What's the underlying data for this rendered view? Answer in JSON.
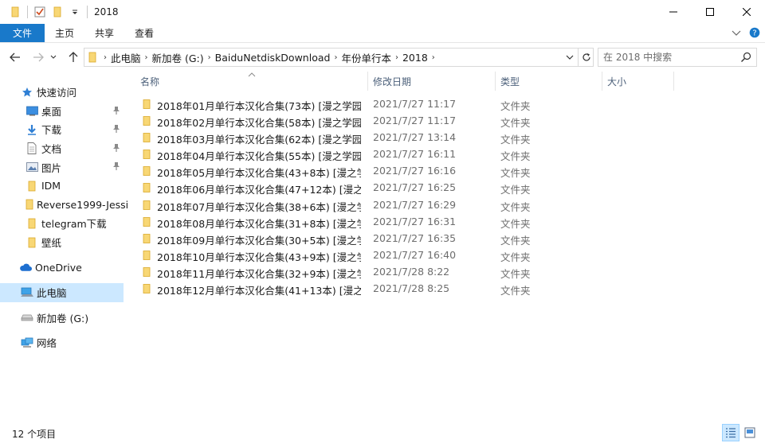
{
  "window": {
    "title": "2018"
  },
  "ribbon": {
    "tabs": [
      "文件",
      "主页",
      "共享",
      "查看"
    ]
  },
  "address": {
    "crumbs": [
      "此电脑",
      "新加卷 (G:)",
      "BaiduNetdiskDownload",
      "年份单行本",
      "2018"
    ]
  },
  "search": {
    "placeholder": "在 2018 中搜索"
  },
  "sidebar": {
    "quick_access": "快速访问",
    "items": [
      {
        "label": "桌面",
        "icon": "desktop-icon",
        "pinned": true
      },
      {
        "label": "下载",
        "icon": "download-icon",
        "pinned": true
      },
      {
        "label": "文档",
        "icon": "document-icon",
        "pinned": true
      },
      {
        "label": "图片",
        "icon": "picture-icon",
        "pinned": true
      },
      {
        "label": "IDM",
        "icon": "folder-icon",
        "pinned": false
      },
      {
        "label": "Reverse1999-Jessi",
        "icon": "folder-icon",
        "pinned": false
      },
      {
        "label": "telegram下载",
        "icon": "folder-icon",
        "pinned": false
      },
      {
        "label": "壁纸",
        "icon": "folder-icon",
        "pinned": false
      }
    ],
    "onedrive": "OneDrive",
    "this_pc": "此电脑",
    "drive": "新加卷 (G:)",
    "network": "网络"
  },
  "columns": {
    "name": "名称",
    "date": "修改日期",
    "type": "类型",
    "size": "大小"
  },
  "files": [
    {
      "name": "2018年01月单行本汉化合集(73本) [漫之学园...",
      "date": "2021/7/27 11:17",
      "type": "文件夹"
    },
    {
      "name": "2018年02月单行本汉化合集(58本) [漫之学园...",
      "date": "2021/7/27 11:17",
      "type": "文件夹"
    },
    {
      "name": "2018年03月单行本汉化合集(62本) [漫之学园...",
      "date": "2021/7/27 13:14",
      "type": "文件夹"
    },
    {
      "name": "2018年04月单行本汉化合集(55本) [漫之学园...",
      "date": "2021/7/27 16:11",
      "type": "文件夹"
    },
    {
      "name": "2018年05月单行本汉化合集(43+8本) [漫之学...",
      "date": "2021/7/27 16:16",
      "type": "文件夹"
    },
    {
      "name": "2018年06月单行本汉化合集(47+12本) [漫之...",
      "date": "2021/7/27 16:25",
      "type": "文件夹"
    },
    {
      "name": "2018年07月单行本汉化合集(38+6本) [漫之学...",
      "date": "2021/7/27 16:29",
      "type": "文件夹"
    },
    {
      "name": "2018年08月单行本汉化合集(31+8本) [漫之学...",
      "date": "2021/7/27 16:31",
      "type": "文件夹"
    },
    {
      "name": "2018年09月单行本汉化合集(30+5本) [漫之学...",
      "date": "2021/7/27 16:35",
      "type": "文件夹"
    },
    {
      "name": "2018年10月单行本汉化合集(43+9本) [漫之学...",
      "date": "2021/7/27 16:40",
      "type": "文件夹"
    },
    {
      "name": "2018年11月单行本汉化合集(32+9本) [漫之学...",
      "date": "2021/7/28 8:22",
      "type": "文件夹"
    },
    {
      "name": "2018年12月单行本汉化合集(41+13本) [漫之...",
      "date": "2021/7/28 8:25",
      "type": "文件夹"
    }
  ],
  "status": {
    "count": "12 个项目"
  },
  "colors": {
    "accent": "#1979ca",
    "folder": "#f8d775",
    "selection": "#cce8ff"
  }
}
